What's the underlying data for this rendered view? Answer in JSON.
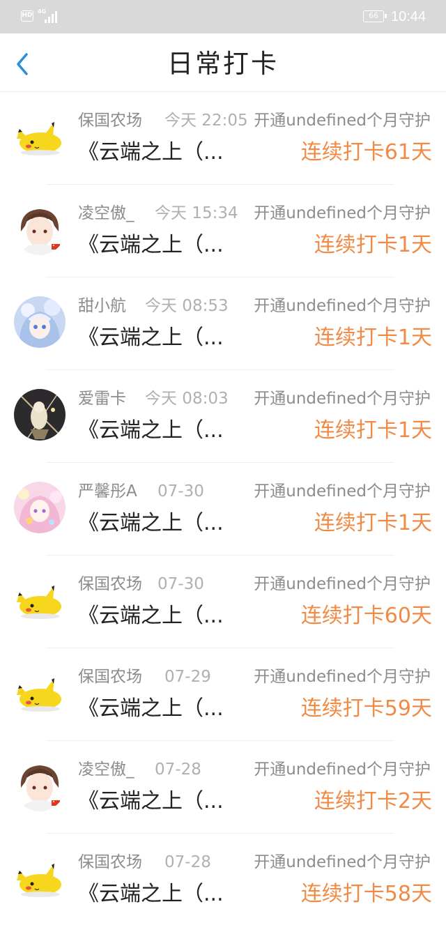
{
  "status_bar": {
    "hd": "HD",
    "network": "4G",
    "battery": "66",
    "time": "10:44"
  },
  "header": {
    "back_icon": "chevron-left-icon",
    "title": "日常打卡"
  },
  "accent_color": "#f08a45",
  "items": [
    {
      "avatar": "pikachu",
      "name": "保国农场",
      "time": "今天 22:05",
      "guard": "开通undefined个月守护",
      "book": "《云端之上（...",
      "streak": "连续打卡61天"
    },
    {
      "avatar": "boy",
      "name": "凌空傲_",
      "time": "今天 15:34",
      "guard": "开通undefined个月守护",
      "book": "《云端之上（...",
      "streak": "连续打卡1天"
    },
    {
      "avatar": "blue-girl",
      "name": "甜小航",
      "time": "今天 08:53",
      "guard": "开通undefined个月守护",
      "book": "《云端之上（...",
      "streak": "连续打卡1天"
    },
    {
      "avatar": "dark-art",
      "name": "爱雷卡",
      "time": "今天 08:03",
      "guard": "开通undefined个月守护",
      "book": "《云端之上（...",
      "streak": "连续打卡1天"
    },
    {
      "avatar": "pink-girl",
      "name": "严馨彤A",
      "time": "07-30",
      "guard": "开通undefined个月守护",
      "book": "《云端之上（...",
      "streak": "连续打卡1天"
    },
    {
      "avatar": "pikachu",
      "name": "保国农场",
      "time": "07-30",
      "guard": "开通undefined个月守护",
      "book": "《云端之上（...",
      "streak": "连续打卡60天"
    },
    {
      "avatar": "pikachu",
      "name": "保国农场",
      "time": "07-29",
      "guard": "开通undefined个月守护",
      "book": "《云端之上（...",
      "streak": "连续打卡59天"
    },
    {
      "avatar": "boy",
      "name": "凌空傲_",
      "time": "07-28",
      "guard": "开通undefined个月守护",
      "book": "《云端之上（...",
      "streak": "连续打卡2天"
    },
    {
      "avatar": "pikachu",
      "name": "保国农场",
      "time": "07-28",
      "guard": "开通undefined个月守护",
      "book": "《云端之上（...",
      "streak": "连续打卡58天"
    }
  ]
}
